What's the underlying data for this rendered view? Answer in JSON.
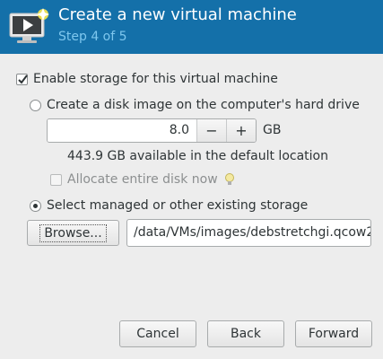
{
  "header": {
    "title": "Create a new virtual machine",
    "subtitle": "Step 4 of 5",
    "icon": "vm-monitor-icon",
    "colors": {
      "background": "#1470a9",
      "title": "#ffffff",
      "subtitle": "#7ec7ee"
    }
  },
  "storage": {
    "enable_label": "Enable storage for this virtual machine",
    "enable_checked": true,
    "create_disk_label": "Create a disk image on the computer's hard drive",
    "create_disk_selected": false,
    "size_value": "8.0",
    "size_unit": "GB",
    "decrement_label": "−",
    "increment_label": "+",
    "available_text": "443.9 GB available in the default location",
    "allocate_label": "Allocate entire disk now",
    "allocate_checked": false,
    "allocate_hint_icon": "lightbulb-icon",
    "select_existing_label": "Select managed or other existing storage",
    "select_existing_selected": true,
    "browse_label": "Browse...",
    "path_value": "/data/VMs/images/debstretchgi.qcow2"
  },
  "footer": {
    "cancel_label": "Cancel",
    "back_label": "Back",
    "forward_label": "Forward"
  }
}
